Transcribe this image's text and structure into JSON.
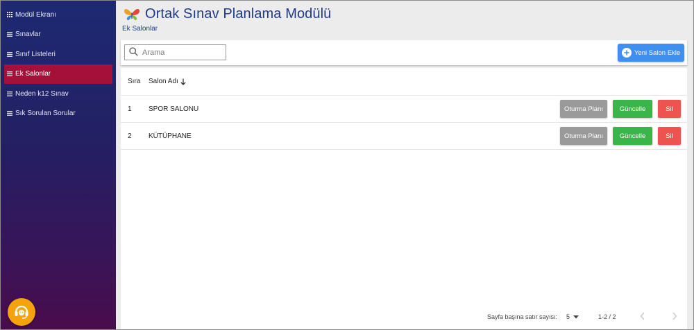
{
  "sidebar": {
    "items": [
      {
        "label": "Modül Ekranı",
        "icon": "grid-icon"
      },
      {
        "label": "Sınavlar",
        "icon": "menu-icon"
      },
      {
        "label": "Sınıf Listeleri",
        "icon": "menu-icon"
      },
      {
        "label": "Ek Salonlar",
        "icon": "menu-icon"
      },
      {
        "label": "Neden k12 Sınav",
        "icon": "menu-icon"
      },
      {
        "label": "Sık Sorulan Sorular",
        "icon": "menu-icon"
      }
    ],
    "active_index": 3
  },
  "header": {
    "title": "Ortak Sınav Planlama Modülü",
    "breadcrumb": "Ek Salonlar"
  },
  "toolbar": {
    "search_placeholder": "Arama",
    "add_button_label": "Yeni Salon Ekle"
  },
  "table": {
    "columns": {
      "index": "Sıra",
      "name": "Salon Adı"
    },
    "rows": [
      {
        "index": "1",
        "name": "SPOR SALONU"
      },
      {
        "index": "2",
        "name": "KÜTÜPHANE"
      }
    ],
    "actions": {
      "seating": "Oturma Planı",
      "update": "Güncelle",
      "delete": "Sil"
    }
  },
  "pagination": {
    "rows_per_page_label": "Sayfa başına satır sayısı:",
    "rows_per_page_value": "5",
    "range": "1-2 / 2"
  },
  "colors": {
    "active_nav": "#a3103a",
    "primary": "#3f8ff0",
    "success": "#3ab54a",
    "danger": "#ef5350",
    "support": "#f5a20f"
  }
}
